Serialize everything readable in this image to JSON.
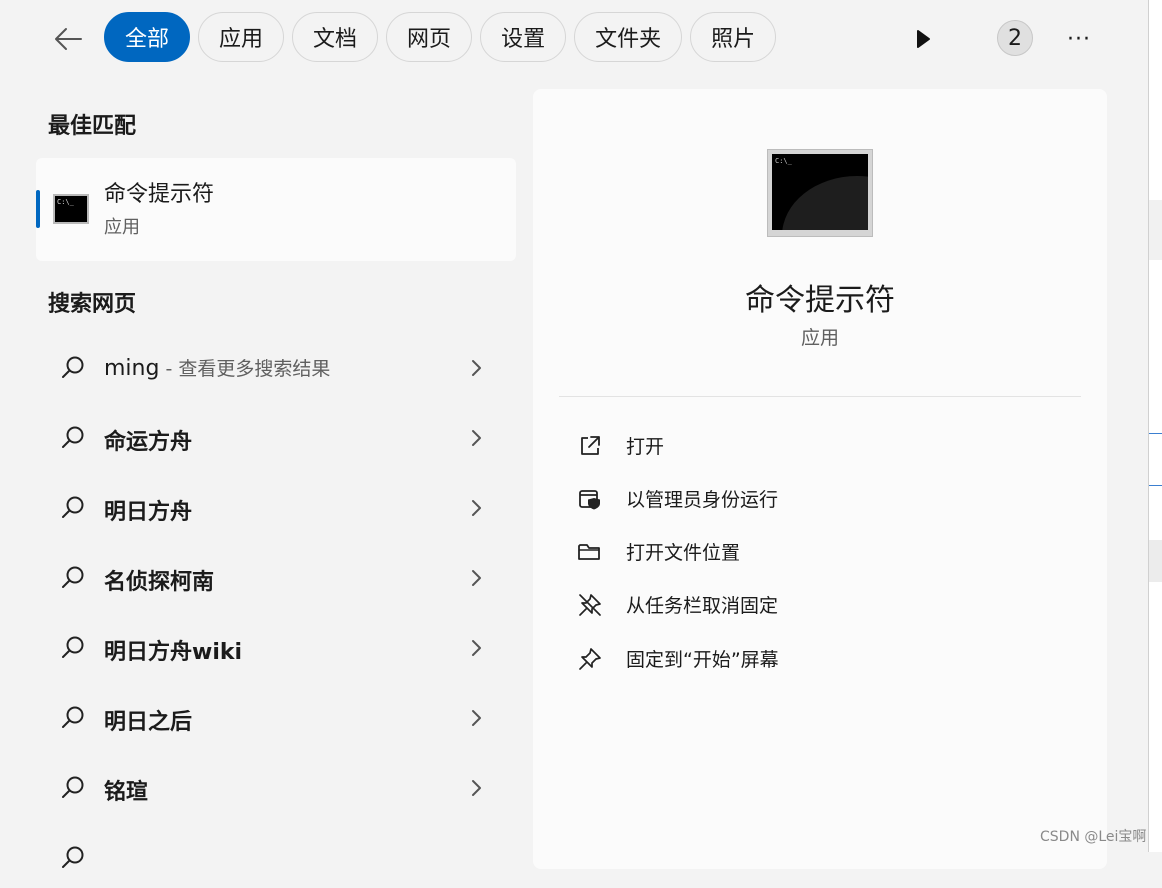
{
  "filters": [
    "全部",
    "应用",
    "文档",
    "网页",
    "设置",
    "文件夹",
    "照片"
  ],
  "badge_count": "2",
  "more_label": "···",
  "best_match": {
    "heading": "最佳匹配",
    "name": "命令提示符",
    "type": "应用"
  },
  "web": {
    "heading": "搜索网页",
    "first": {
      "query": "ming",
      "hint": " - 查看更多搜索结果"
    },
    "items": [
      "命运方舟",
      "明日方舟",
      "名侦探柯南",
      "明日方舟wiki",
      "明日之后",
      "铭瑄"
    ]
  },
  "detail": {
    "name": "命令提示符",
    "type": "应用",
    "actions": [
      "打开",
      "以管理员身份运行",
      "打开文件位置",
      "从任务栏取消固定",
      "固定到“开始”屏幕"
    ]
  },
  "watermark": "CSDN @Lei宝啊"
}
